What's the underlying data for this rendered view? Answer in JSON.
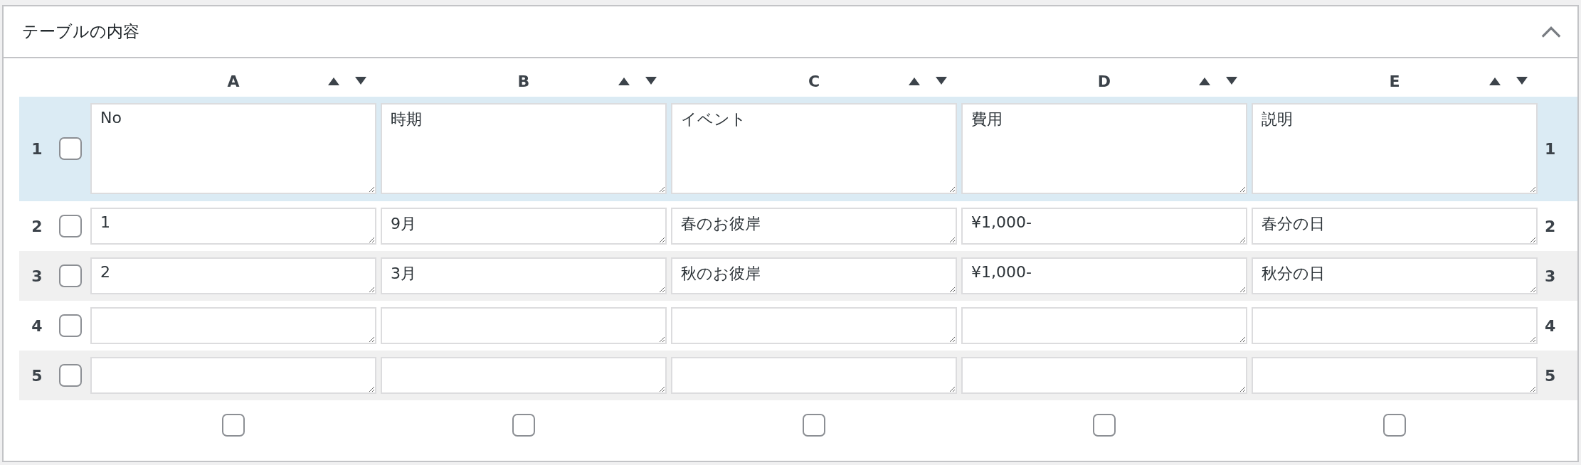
{
  "panel": {
    "title": "テーブルの内容",
    "expanded": true
  },
  "columns": [
    {
      "label": "A"
    },
    {
      "label": "B"
    },
    {
      "label": "C"
    },
    {
      "label": "D"
    },
    {
      "label": "E"
    }
  ],
  "rows": [
    {
      "number": "1",
      "number_end": "1",
      "checked": false,
      "header": true,
      "cells": [
        "No",
        "時期",
        "イベント",
        "費用",
        "説明"
      ]
    },
    {
      "number": "2",
      "number_end": "2",
      "checked": false,
      "header": false,
      "cells": [
        "1",
        "9月",
        "春のお彼岸",
        "¥1,000-",
        "春分の日"
      ]
    },
    {
      "number": "3",
      "number_end": "3",
      "checked": false,
      "header": false,
      "cells": [
        "2",
        "3月",
        "秋のお彼岸",
        "¥1,000-",
        "秋分の日"
      ]
    },
    {
      "number": "4",
      "number_end": "4",
      "checked": false,
      "header": false,
      "cells": [
        "",
        "",
        "",
        "",
        ""
      ]
    },
    {
      "number": "5",
      "number_end": "5",
      "checked": false,
      "header": false,
      "cells": [
        "",
        "",
        "",
        "",
        ""
      ]
    }
  ],
  "column_checkboxes": [
    {
      "checked": false
    },
    {
      "checked": false
    },
    {
      "checked": false
    },
    {
      "checked": false
    },
    {
      "checked": false
    }
  ]
}
